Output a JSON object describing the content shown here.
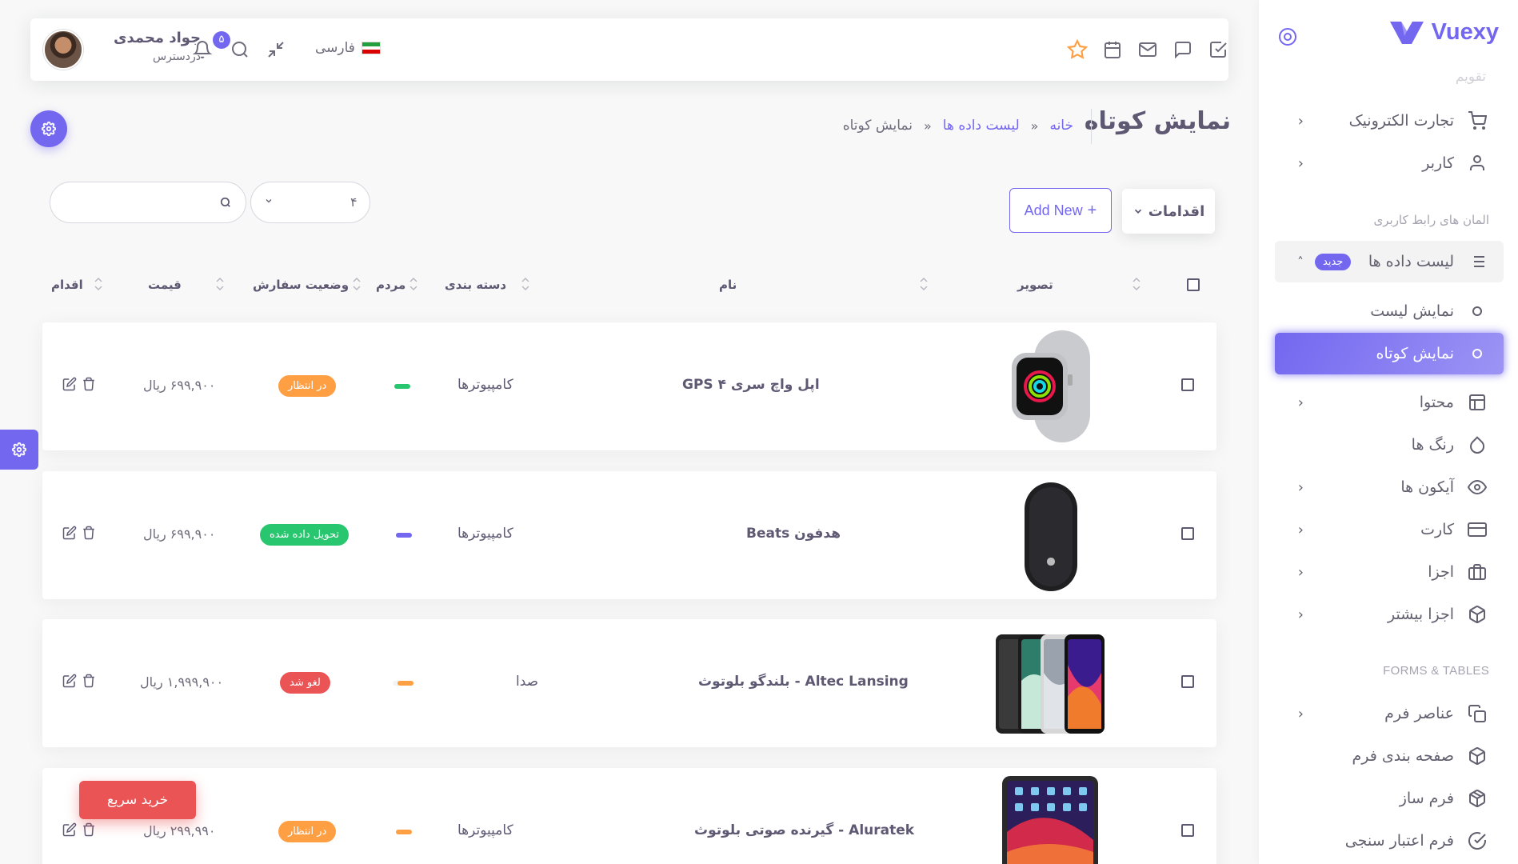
{
  "brand": {
    "name": "Vuexy"
  },
  "sidebar": {
    "faded_label": "تقویم",
    "items_top": [
      {
        "label": "تجارت الکترونیک",
        "icon": "cart-icon"
      },
      {
        "label": "کاربر",
        "icon": "user-icon"
      }
    ],
    "section_ui": "المان های رابط کاربری",
    "datatable": {
      "label": "لیست داده ها",
      "badge": "جدید"
    },
    "sub_items": [
      {
        "label": "نمایش لیست"
      },
      {
        "label": "نمایش کوتاه"
      }
    ],
    "items_mid": [
      {
        "label": "محتوا",
        "icon": "layout-icon"
      },
      {
        "label": "رنگ ها",
        "icon": "droplet-icon"
      },
      {
        "label": "آیکون ها",
        "icon": "eye-icon"
      },
      {
        "label": "کارت",
        "icon": "credit-card-icon"
      },
      {
        "label": "اجزا",
        "icon": "briefcase-icon"
      },
      {
        "label": "اجزا بیشتر",
        "icon": "box-icon"
      }
    ],
    "section_forms": "FORMS & TABLES",
    "items_forms": [
      {
        "label": "عناصر فرم",
        "icon": "copy-icon"
      },
      {
        "label": "صفحه بندی فرم",
        "icon": "box-icon"
      },
      {
        "label": "فرم ساز",
        "icon": "package-icon"
      },
      {
        "label": "فرم اعتبار سنجی",
        "icon": "check-circle-icon"
      }
    ]
  },
  "navbar": {
    "user_name": "جواد محمدی",
    "user_role": "دردسترس",
    "notifications_count": "۵",
    "language": "فارسی"
  },
  "page": {
    "title": "نمایش کوتاه",
    "breadcrumb": [
      "خانه",
      "لیست داده ها",
      "نمایش کوتاه"
    ]
  },
  "controls": {
    "actions_label": "اقدامات",
    "add_new_label": "Add New",
    "per_page": "۴",
    "search_value": ""
  },
  "table": {
    "headers": {
      "image": "تصویر",
      "name": "نام",
      "category": "دسته بندی",
      "popularity": "مردم",
      "status": "وضعیت سفارش",
      "price": "قیمت",
      "action": "اقدام"
    },
    "rows": [
      {
        "name": "اپل واچ سری ۴ GPS",
        "category": "کامپیوترها",
        "popularity_color": "#28c76f",
        "status": "در انتظار",
        "status_type": "warning",
        "price": "۶۹۹,۹۰۰ ریال",
        "image": "apple-watch"
      },
      {
        "name": "هدفون Beats",
        "category": "کامپیوترها",
        "popularity_color": "#7367f0",
        "status": "تحویل داده شده",
        "status_type": "success",
        "price": "۶۹۹,۹۰۰ ریال",
        "image": "magic-mouse"
      },
      {
        "name": "Altec Lansing - بلندگو بلوتوث",
        "category": "صدا",
        "popularity_color": "#ff9f43",
        "status": "لغو شد",
        "status_type": "danger",
        "price": "۱,۹۹۹,۹۰۰ ریال",
        "image": "iphones"
      },
      {
        "name": "Aluratek - گیرنده صوتی بلوتوث",
        "category": "کامپیوترها",
        "popularity_color": "#ff9f43",
        "status": "در انتظار",
        "status_type": "warning",
        "price": "۲۹۹,۹۹۰ ریال",
        "image": "ipad"
      }
    ]
  },
  "floating": {
    "buy_now": "خرید سریع"
  },
  "colors": {
    "primary": "#7367f0",
    "success": "#28c76f",
    "warning": "#ff9f43",
    "danger": "#ea5455"
  }
}
